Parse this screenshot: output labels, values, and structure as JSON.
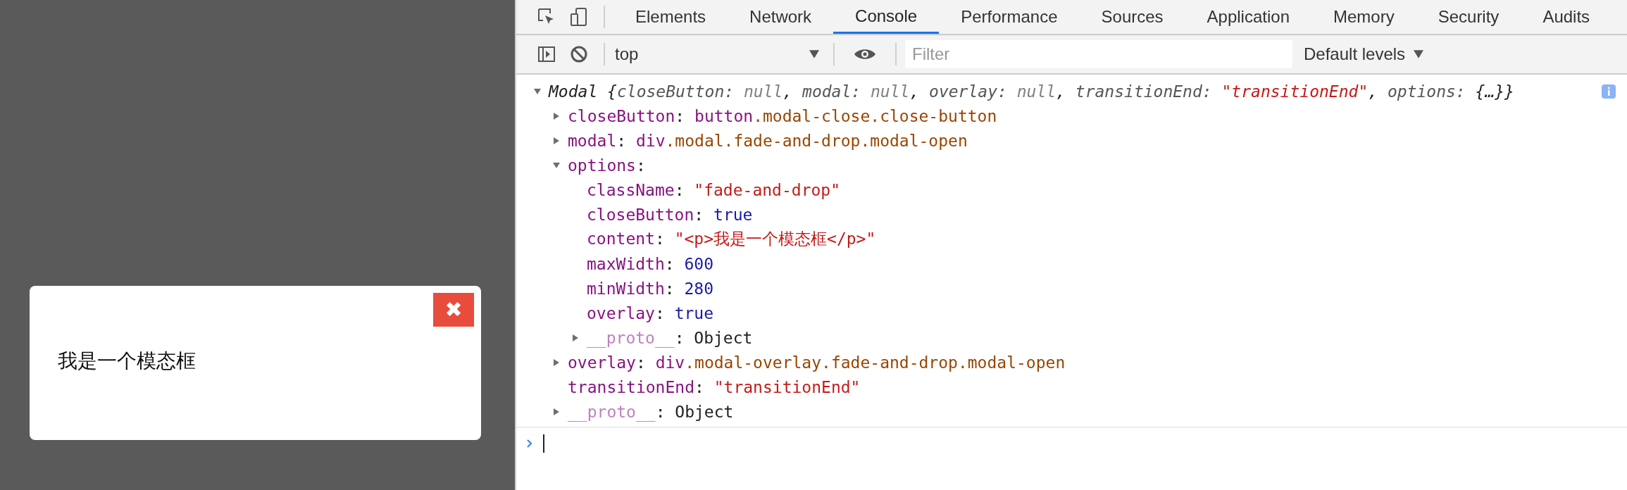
{
  "page": {
    "modal": {
      "text": "我是一个模态框",
      "close_glyph": "✖"
    }
  },
  "devtools": {
    "tabs": [
      {
        "label": "Elements",
        "selected": false
      },
      {
        "label": "Network",
        "selected": false
      },
      {
        "label": "Console",
        "selected": true
      },
      {
        "label": "Performance",
        "selected": false
      },
      {
        "label": "Sources",
        "selected": false
      },
      {
        "label": "Application",
        "selected": false
      },
      {
        "label": "Memory",
        "selected": false
      },
      {
        "label": "Security",
        "selected": false
      },
      {
        "label": "Audits",
        "selected": false
      }
    ],
    "toolbar": {
      "context": "top",
      "filter": {
        "placeholder": "Filter"
      },
      "levels": "Default levels"
    },
    "console": {
      "entries": [
        {
          "kind": "object",
          "expanded": true,
          "preview": [
            {
              "text": "Modal {",
              "kind": "name"
            },
            {
              "text": "closeButton: ",
              "kind": "prop"
            },
            {
              "text": "null",
              "kind": "null"
            },
            {
              "text": ", ",
              "kind": "name"
            },
            {
              "text": "modal: ",
              "kind": "prop"
            },
            {
              "text": "null",
              "kind": "null"
            },
            {
              "text": ", ",
              "kind": "name"
            },
            {
              "text": "overlay: ",
              "kind": "prop"
            },
            {
              "text": "null",
              "kind": "null"
            },
            {
              "text": ", ",
              "kind": "name"
            },
            {
              "text": "transitionEnd: ",
              "kind": "prop"
            },
            {
              "text": "\"transitionEnd\"",
              "kind": "string"
            },
            {
              "text": ", ",
              "kind": "name"
            },
            {
              "text": "options: ",
              "kind": "prop"
            },
            {
              "text": "{…}}",
              "kind": "name"
            }
          ],
          "children": [
            {
              "kind": "object",
              "expanded": false,
              "key": "closeButton",
              "internal": false,
              "value": [
                {
                  "text": ": ",
                  "kind": "plain"
                },
                {
                  "text": "button",
                  "kind": "tag"
                },
                {
                  "text": ".modal-close.close-button",
                  "kind": "class"
                }
              ]
            },
            {
              "kind": "object",
              "expanded": false,
              "key": "modal",
              "internal": false,
              "value": [
                {
                  "text": ": ",
                  "kind": "plain"
                },
                {
                  "text": "div",
                  "kind": "tag"
                },
                {
                  "text": ".modal.fade-and-drop.modal-open",
                  "kind": "class"
                }
              ]
            },
            {
              "kind": "object",
              "expanded": true,
              "key": "options",
              "internal": false,
              "value": [
                {
                  "text": ":",
                  "kind": "plain"
                }
              ],
              "children": [
                {
                  "kind": "value",
                  "key": "className",
                  "internal": false,
                  "value": [
                    {
                      "text": ": ",
                      "kind": "plain"
                    },
                    {
                      "text": "\"fade-and-drop\"",
                      "kind": "string"
                    }
                  ]
                },
                {
                  "kind": "value",
                  "key": "closeButton",
                  "internal": false,
                  "value": [
                    {
                      "text": ": ",
                      "kind": "plain"
                    },
                    {
                      "text": "true",
                      "kind": "number"
                    }
                  ]
                },
                {
                  "kind": "value",
                  "key": "content",
                  "internal": false,
                  "value": [
                    {
                      "text": ": ",
                      "kind": "plain"
                    },
                    {
                      "text": "\"<p>我是一个模态框</p>\"",
                      "kind": "string"
                    }
                  ]
                },
                {
                  "kind": "value",
                  "key": "maxWidth",
                  "internal": false,
                  "value": [
                    {
                      "text": ": ",
                      "kind": "plain"
                    },
                    {
                      "text": "600",
                      "kind": "number"
                    }
                  ]
                },
                {
                  "kind": "value",
                  "key": "minWidth",
                  "internal": false,
                  "value": [
                    {
                      "text": ": ",
                      "kind": "plain"
                    },
                    {
                      "text": "280",
                      "kind": "number"
                    }
                  ]
                },
                {
                  "kind": "value",
                  "key": "overlay",
                  "internal": false,
                  "value": [
                    {
                      "text": ": ",
                      "kind": "plain"
                    },
                    {
                      "text": "true",
                      "kind": "number"
                    }
                  ]
                },
                {
                  "kind": "object",
                  "expanded": false,
                  "key": "__proto__",
                  "internal": true,
                  "value": [
                    {
                      "text": ": ",
                      "kind": "plain"
                    },
                    {
                      "text": "Object",
                      "kind": "plain"
                    }
                  ]
                }
              ]
            },
            {
              "kind": "object",
              "expanded": false,
              "key": "overlay",
              "internal": false,
              "value": [
                {
                  "text": ": ",
                  "kind": "plain"
                },
                {
                  "text": "div",
                  "kind": "tag"
                },
                {
                  "text": ".modal-overlay.fade-and-drop.modal-open",
                  "kind": "class"
                }
              ]
            },
            {
              "kind": "value",
              "key": "transitionEnd",
              "internal": false,
              "value": [
                {
                  "text": ": ",
                  "kind": "plain"
                },
                {
                  "text": "\"transitionEnd\"",
                  "kind": "string"
                }
              ]
            },
            {
              "kind": "object",
              "expanded": false,
              "key": "__proto__",
              "internal": true,
              "value": [
                {
                  "text": ": ",
                  "kind": "plain"
                },
                {
                  "text": "Object",
                  "kind": "plain"
                }
              ]
            }
          ]
        }
      ]
    }
  }
}
